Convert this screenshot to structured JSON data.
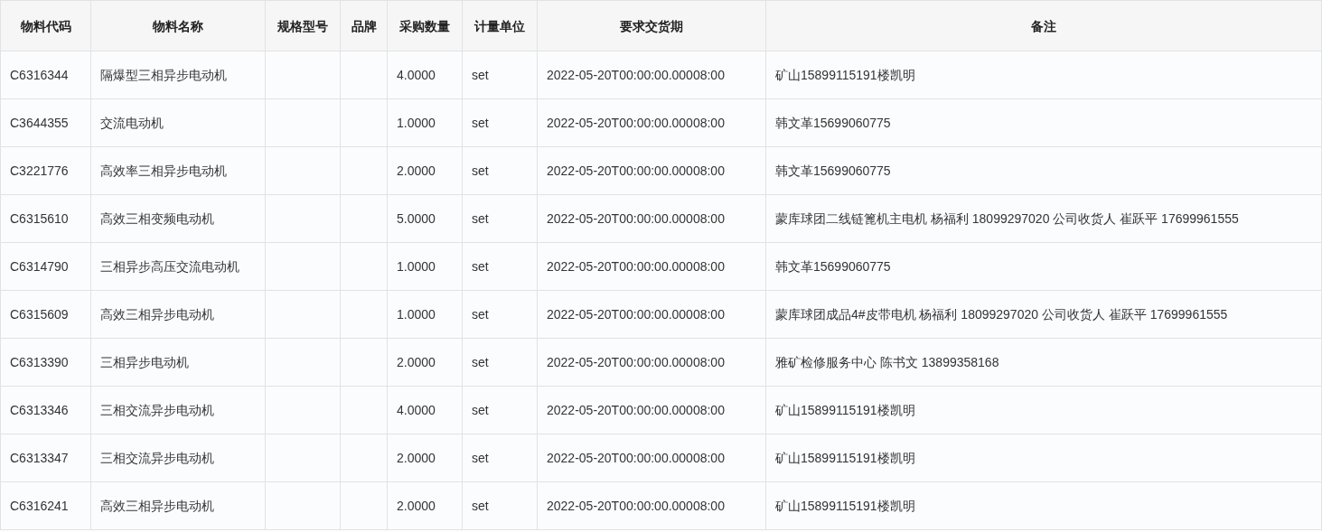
{
  "table": {
    "columns": [
      "物料代码",
      "物料名称",
      "规格型号",
      "品牌",
      "采购数量",
      "计量单位",
      "要求交货期",
      "备注"
    ],
    "rows": [
      {
        "code": "C6316344",
        "name": "隔爆型三相异步电动机",
        "quantity": "4.0000",
        "unit": "set",
        "delivery_date": "2022-05-20T00:00:00.00008:00",
        "remark": "矿山15899115191楼凯明"
      },
      {
        "code": "C3644355",
        "name": "交流电动机",
        "quantity": "1.0000",
        "unit": "set",
        "delivery_date": "2022-05-20T00:00:00.00008:00",
        "remark": "韩文革15699060775"
      },
      {
        "code": "C3221776",
        "name": "高效率三相异步电动机",
        "quantity": "2.0000",
        "unit": "set",
        "delivery_date": "2022-05-20T00:00:00.00008:00",
        "remark": "韩文革15699060775"
      },
      {
        "code": "C6315610",
        "name": "高效三相变频电动机",
        "quantity": "5.0000",
        "unit": "set",
        "delivery_date": "2022-05-20T00:00:00.00008:00",
        "remark": "蒙库球团二线链篦机主电机 杨福利 18099297020 公司收货人 崔跃平 17699961555"
      },
      {
        "code": "C6314790",
        "name": "三相异步高压交流电动机",
        "quantity": "1.0000",
        "unit": "set",
        "delivery_date": "2022-05-20T00:00:00.00008:00",
        "remark": "韩文革15699060775"
      },
      {
        "code": "C6315609",
        "name": "高效三相异步电动机",
        "quantity": "1.0000",
        "unit": "set",
        "delivery_date": "2022-05-20T00:00:00.00008:00",
        "remark": "蒙库球团成品4#皮带电机 杨福利 18099297020 公司收货人 崔跃平 17699961555"
      },
      {
        "code": "C6313390",
        "name": "三相异步电动机",
        "quantity": "2.0000",
        "unit": "set",
        "delivery_date": "2022-05-20T00:00:00.00008:00",
        "remark": "雅矿检修服务中心 陈书文 13899358168"
      },
      {
        "code": "C6313346",
        "name": "三相交流异步电动机",
        "quantity": "4.0000",
        "unit": "set",
        "delivery_date": "2022-05-20T00:00:00.00008:00",
        "remark": "矿山15899115191楼凯明"
      },
      {
        "code": "C6313347",
        "name": "三相交流异步电动机",
        "quantity": "2.0000",
        "unit": "set",
        "delivery_date": "2022-05-20T00:00:00.00008:00",
        "remark": "矿山15899115191楼凯明"
      },
      {
        "code": "C6316241",
        "name": "高效三相异步电动机",
        "quantity": "2.0000",
        "unit": "set",
        "delivery_date": "2022-05-20T00:00:00.00008:00",
        "remark": "矿山15899115191楼凯明"
      }
    ]
  }
}
